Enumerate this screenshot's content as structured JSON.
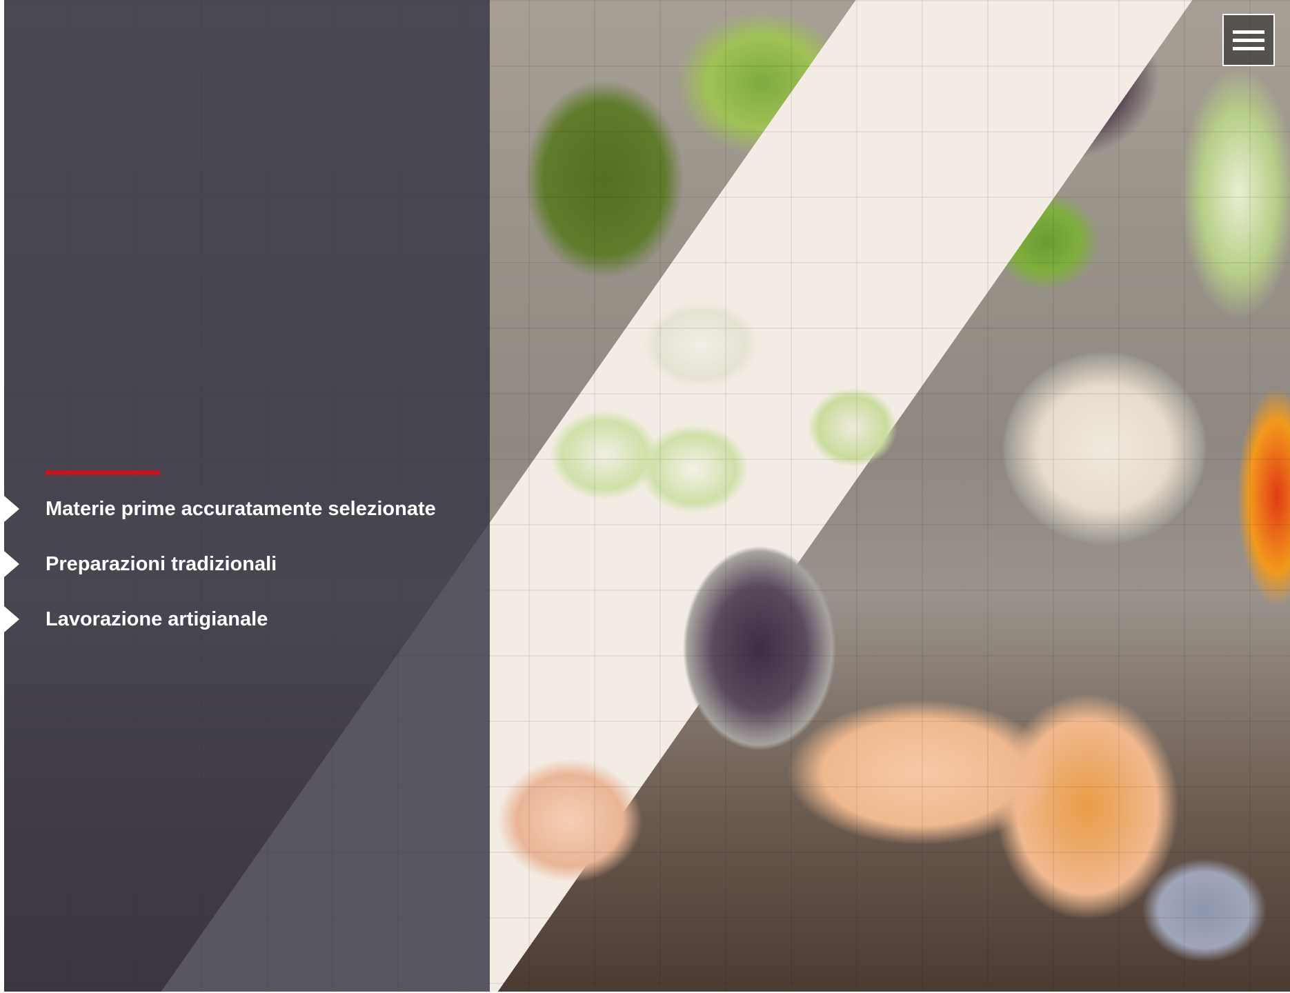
{
  "hero": {
    "accent_color": "#c4151c",
    "overlay_color": "#373544"
  },
  "features": {
    "items": [
      {
        "label": "Materie prime accuratamente selezionate"
      },
      {
        "label": "Preparazioni tradizionali"
      },
      {
        "label": "Lavorazione artigianale"
      }
    ]
  },
  "menu": {
    "icon": "hamburger-menu-icon"
  }
}
